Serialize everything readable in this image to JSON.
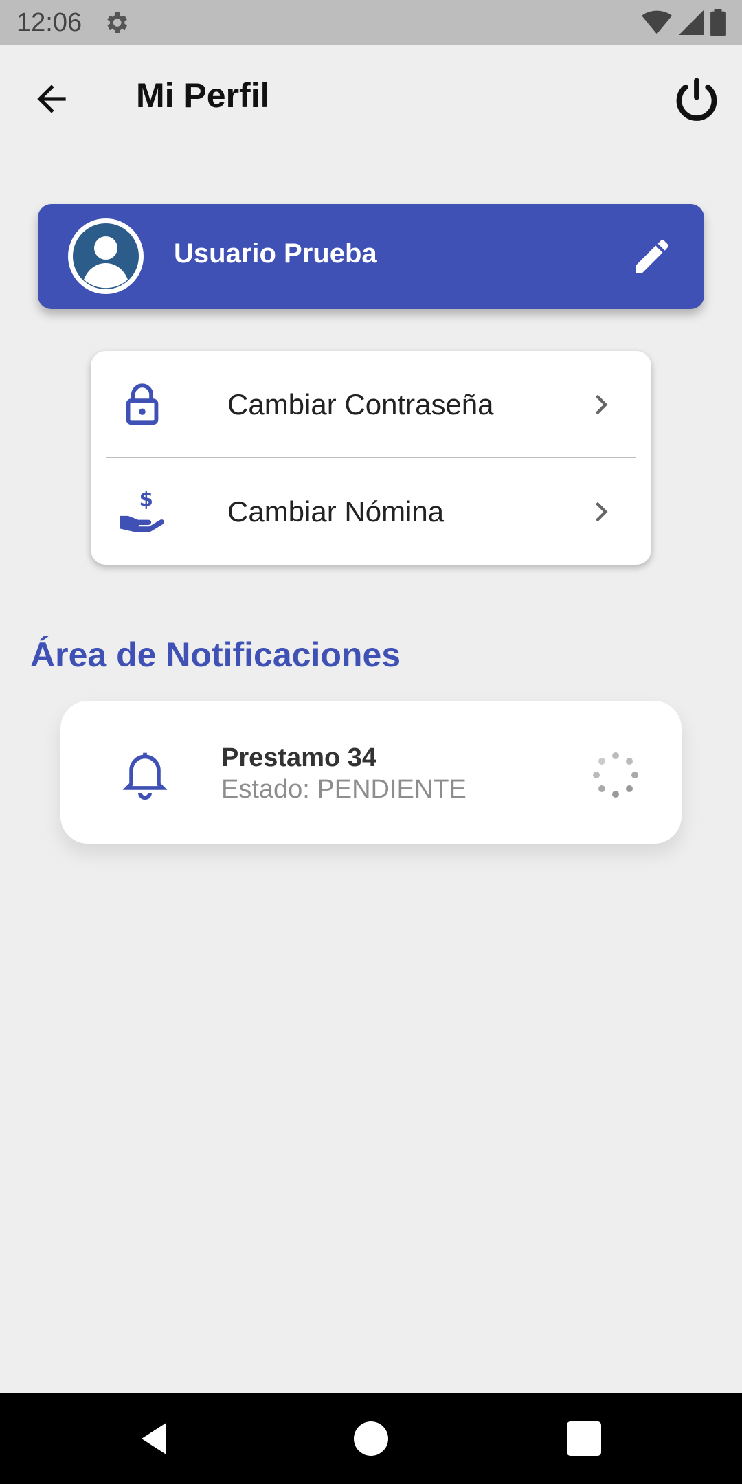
{
  "status_bar": {
    "time": "12:06"
  },
  "app_bar": {
    "title": "Mi Perfil"
  },
  "profile": {
    "name": "Usuario Prueba"
  },
  "options": [
    {
      "label": "Cambiar Contraseña",
      "icon": "lock-icon"
    },
    {
      "label": "Cambiar Nómina",
      "icon": "hand-money-icon"
    }
  ],
  "notifications": {
    "section_title": "Área de Notificaciones",
    "items": [
      {
        "title": "Prestamo 34",
        "subtitle": "Estado: PENDIENTE",
        "icon": "bell-icon"
      }
    ]
  },
  "colors": {
    "primary": "#3f51b5",
    "background": "#eeeeee",
    "status_bar": "#bdbdbd"
  }
}
